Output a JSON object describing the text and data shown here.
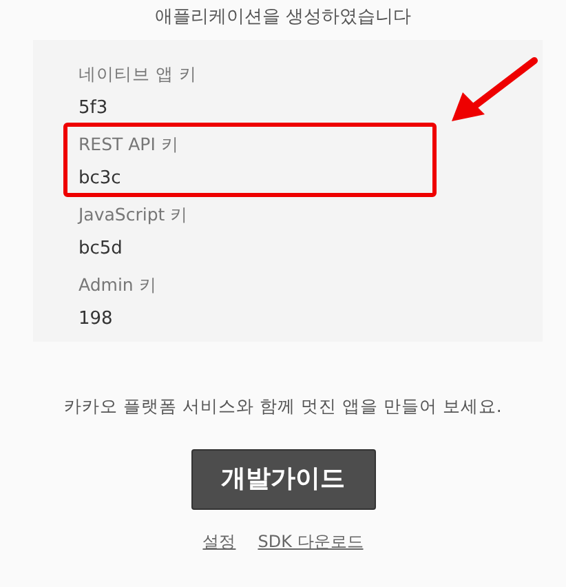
{
  "subtitle": "애플리케이션을 생성하였습니다",
  "keys": [
    {
      "label": "네이티브 앱 키",
      "value": "5f3",
      "highlighted": false
    },
    {
      "label": "REST API 키",
      "value": "bc3c",
      "highlighted": true
    },
    {
      "label": "JavaScript 키",
      "value": "bc5d",
      "highlighted": false
    },
    {
      "label": "Admin 키",
      "value": "198",
      "highlighted": false
    }
  ],
  "message": "카카오 플랫폼 서비스와 함께 멋진 앱을 만들어 보세요.",
  "guide_button": "개발가이드",
  "links": [
    "설정",
    "SDK 다운로드"
  ]
}
